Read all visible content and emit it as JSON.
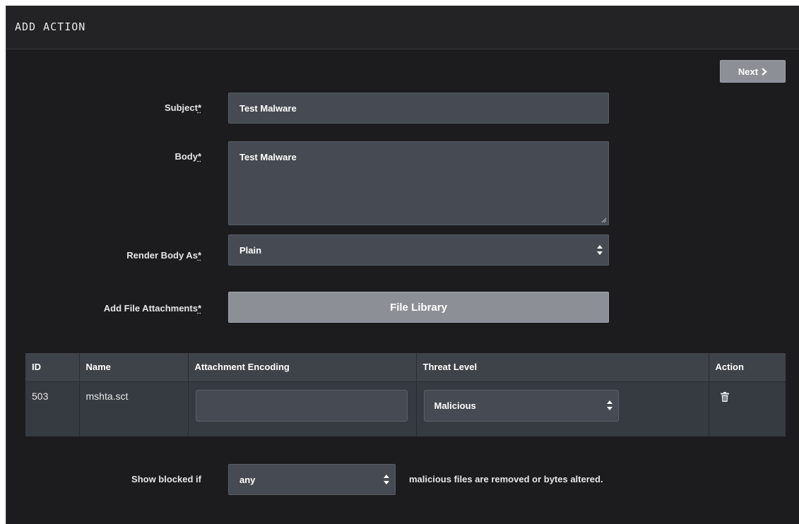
{
  "header": {
    "title": "ADD ACTION"
  },
  "next_button": {
    "label": "Next"
  },
  "form": {
    "subject": {
      "label": "Subject",
      "required_mark": "*",
      "value": "Test Malware"
    },
    "body": {
      "label": "Body",
      "required_mark": "*",
      "value": "Test Malware"
    },
    "render_body_as": {
      "label": "Render Body As",
      "required_mark": "*",
      "selected": "Plain"
    },
    "file_attachments": {
      "label": "Add File Attachments",
      "required_mark": "*",
      "button_label": "File Library"
    }
  },
  "attachments_table": {
    "columns": [
      "ID",
      "Name",
      "Attachment Encoding",
      "Threat Level",
      "Action"
    ],
    "rows": [
      {
        "id": "503",
        "name": "mshta.sct",
        "encoding": "",
        "threat_level": "Malicious"
      }
    ]
  },
  "blocked": {
    "label": "Show blocked if",
    "selected": "any",
    "suffix": "malicious files are removed or bytes altered."
  },
  "icons": {
    "next": "chevron-right-icon",
    "select": "updown-arrows-icon",
    "delete": "trash-icon",
    "resize": "resize-grip-icon"
  },
  "colors": {
    "background": "#1c1c1e",
    "field": "#464a52",
    "button": "#8c8f96",
    "table_header": "#3e4249",
    "table_row": "#363a41"
  }
}
